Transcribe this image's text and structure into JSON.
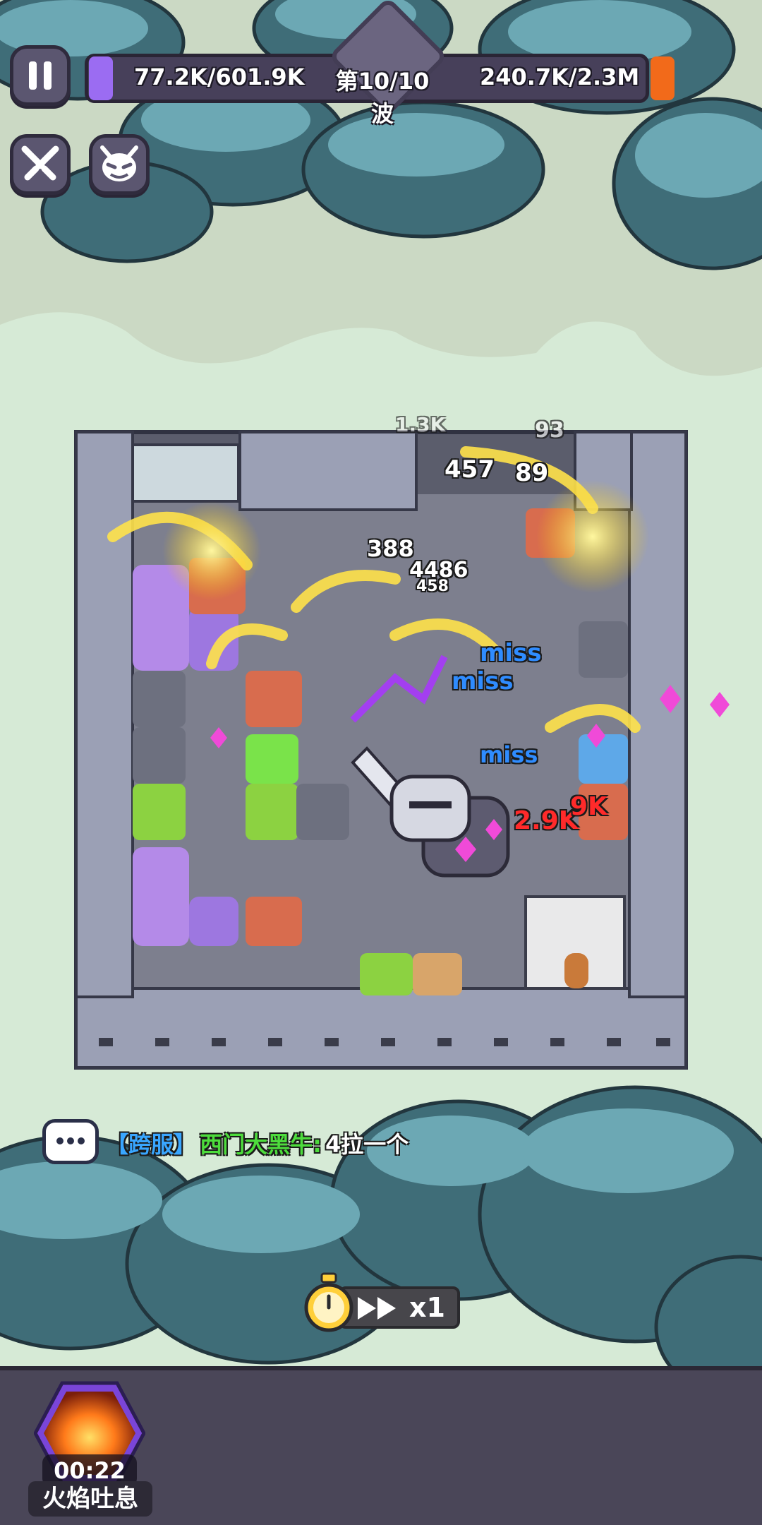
{
  "hud": {
    "left_value": "77.2K/601.9K",
    "wave_label": "第10/10波",
    "right_value": "240.7K/2.3M"
  },
  "icons": {
    "pause": "pause-icon",
    "cross": "crossed-swords-icon",
    "demon": "demon-face-icon",
    "chat": "chat-bubble-icon",
    "stopwatch": "stopwatch-icon",
    "fast_forward": "fast-forward-icon"
  },
  "chat": {
    "channel": "【跨服】",
    "sender": "西门大黑牛:",
    "message": "4拉一个"
  },
  "speed": {
    "label": "x1"
  },
  "skill": {
    "timer": "00:22",
    "name": "火焰吐息"
  },
  "combat_text": {
    "dmg_1": "1.3K",
    "dmg_2": "93",
    "dmg_3": "457",
    "dmg_4": "89",
    "dmg_5": "388",
    "dmg_6": "4486",
    "dmg_7": "458",
    "miss_1": "miss",
    "miss_2": "miss",
    "miss_3": "miss",
    "crit_1": "2.9K",
    "crit_2": "9K"
  },
  "colors": {
    "hud_bar": "#47405a",
    "left_gauge": "#9b6cf2",
    "right_gauge": "#f26a1a",
    "chat_channel": "#39a6ff",
    "chat_sender": "#4ddc3c",
    "panel": "#4a4658",
    "crit": "#ff2a2a",
    "miss": "#2f8cff"
  }
}
